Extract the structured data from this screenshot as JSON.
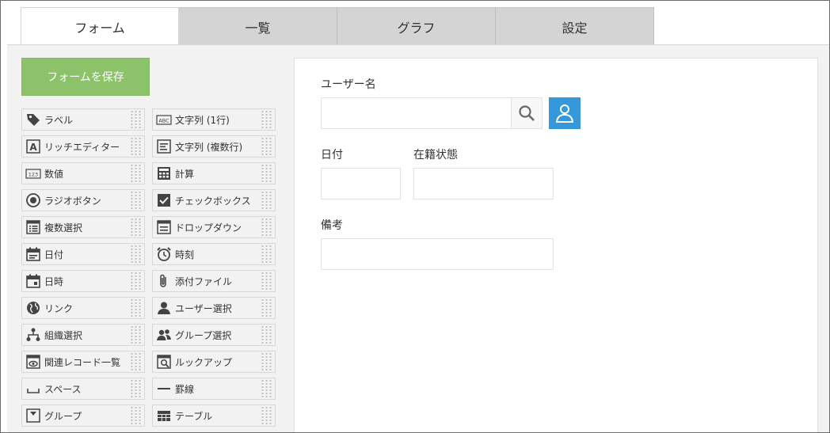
{
  "tabs": [
    "フォーム",
    "一覧",
    "グラフ",
    "設定"
  ],
  "save_button": "フォームを保存",
  "palette": [
    {
      "label": "ラベル",
      "icon": "label-tag-icon"
    },
    {
      "label": "文字列 (1行)",
      "icon": "text-abc-icon"
    },
    {
      "label": "リッチエディター",
      "icon": "rich-editor-icon"
    },
    {
      "label": "文字列 (複数行)",
      "icon": "multiline-text-icon"
    },
    {
      "label": "数値",
      "icon": "number-123-icon"
    },
    {
      "label": "計算",
      "icon": "calculator-icon"
    },
    {
      "label": "ラジオボタン",
      "icon": "radio-button-icon"
    },
    {
      "label": "チェックボックス",
      "icon": "checkbox-icon"
    },
    {
      "label": "複数選択",
      "icon": "multi-select-icon"
    },
    {
      "label": "ドロップダウン",
      "icon": "dropdown-icon"
    },
    {
      "label": "日付",
      "icon": "calendar-date-icon"
    },
    {
      "label": "時刻",
      "icon": "alarm-clock-icon"
    },
    {
      "label": "日時",
      "icon": "calendar-datetime-icon"
    },
    {
      "label": "添付ファイル",
      "icon": "paperclip-icon"
    },
    {
      "label": "リンク",
      "icon": "globe-link-icon"
    },
    {
      "label": "ユーザー選択",
      "icon": "user-icon"
    },
    {
      "label": "組織選択",
      "icon": "org-tree-icon"
    },
    {
      "label": "グループ選択",
      "icon": "group-users-icon"
    },
    {
      "label": "関連レコード一覧",
      "icon": "related-records-icon"
    },
    {
      "label": "ルックアップ",
      "icon": "lookup-icon"
    },
    {
      "label": "スペース",
      "icon": "space-icon"
    },
    {
      "label": "罫線",
      "icon": "horizontal-rule-icon"
    },
    {
      "label": "グループ",
      "icon": "group-fold-icon"
    },
    {
      "label": "テーブル",
      "icon": "table-icon"
    }
  ],
  "form": {
    "username_label": "ユーザー名",
    "date_label": "日付",
    "status_label": "在籍状態",
    "notes_label": "備考"
  },
  "colors": {
    "save_button": "#8cc269",
    "user_button": "#3498db",
    "tab_inactive": "#d4d4d4",
    "background": "#f2f2f2"
  }
}
